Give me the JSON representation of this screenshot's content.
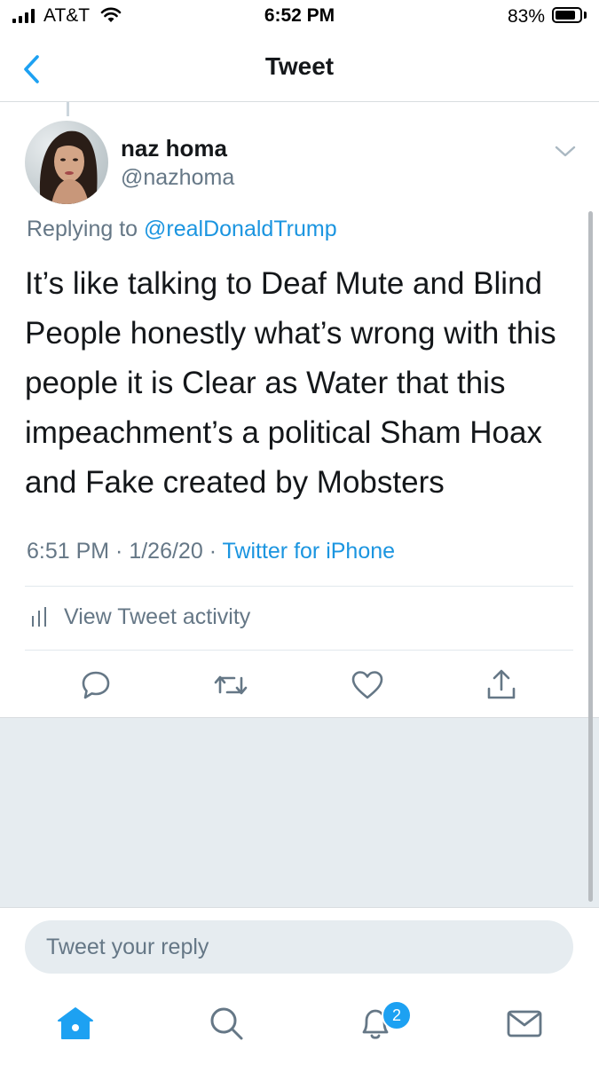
{
  "status_bar": {
    "carrier": "AT&T",
    "time": "6:52 PM",
    "battery_percent": "83%",
    "battery_level": 0.83
  },
  "nav": {
    "title": "Tweet",
    "back_icon": "chevron-left-icon"
  },
  "tweet": {
    "author_name": "naz homa",
    "author_handle": "@nazhoma",
    "replying_prefix": "Replying to ",
    "replying_to": "@realDonaldTrump",
    "text": "It’s like talking to Deaf Mute and Blind People honestly what’s wrong with this people it is Clear as Water that this impeachment’s a political Sham Hoax and Fake created by Mobsters",
    "time": "6:51 PM",
    "separator": " · ",
    "date": "1/26/20",
    "source": "Twitter for iPhone",
    "activity_label": "View Tweet activity"
  },
  "actions": [
    "reply-icon",
    "retweet-icon",
    "like-icon",
    "share-icon"
  ],
  "reply": {
    "placeholder": "Tweet your reply"
  },
  "tabbar": {
    "items": [
      "home-icon",
      "search-icon",
      "notifications-icon",
      "messages-icon"
    ],
    "notification_count": "2"
  },
  "colors": {
    "accent": "#1da1f2",
    "link": "#1b95e0",
    "secondary_text": "#657786",
    "background_gray": "#e6ecf0"
  }
}
